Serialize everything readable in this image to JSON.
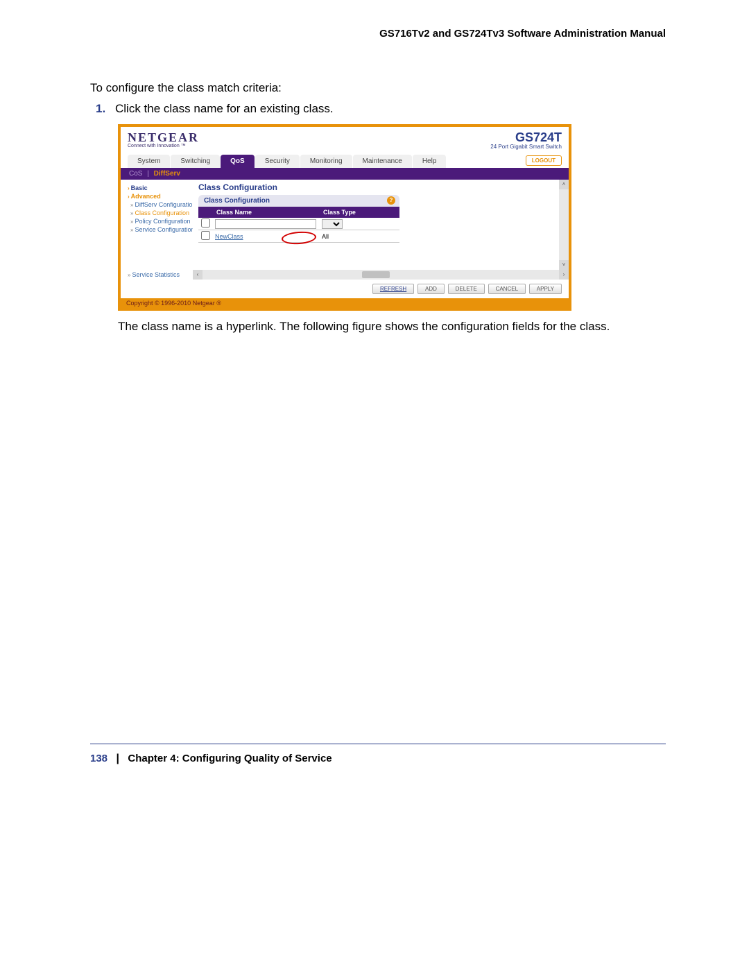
{
  "doc": {
    "header": "GS716Tv2 and GS724Tv3 Software Administration Manual",
    "intro": "To configure the class match criteria:",
    "step_num": "1.",
    "step_text": "Click the class name for an existing class.",
    "post_text": "The class name is a hyperlink. The following figure shows the configuration fields for the class.",
    "page_num": "138",
    "footer_sep": "|",
    "chapter": "Chapter 4:  Configuring Quality of Service"
  },
  "ss": {
    "logo": "NETGEAR",
    "logo_tag": "Connect with Innovation ™",
    "product": "GS724T",
    "product_tag": "24 Port Gigabit Smart Switch",
    "logout": "LOGOUT",
    "tabs": [
      "System",
      "Switching",
      "QoS",
      "Security",
      "Monitoring",
      "Maintenance",
      "Help"
    ],
    "active_tab": "QoS",
    "subtabs": {
      "a": "CoS",
      "b": "DiffServ",
      "sep": "|"
    },
    "sidebar": {
      "basic": "Basic",
      "advanced": "Advanced",
      "i0": "DiffServ Configuration",
      "i1": "Class Configuration",
      "i2": "Policy Configuration",
      "i3": "Service Configuration",
      "i4": "Service Statistics"
    },
    "main_title": "Class Configuration",
    "panel_title": "Class Configuration",
    "help_icon": "?",
    "th_name": "Class Name",
    "th_type": "Class Type",
    "row_link": "NewClass",
    "row_type": "All",
    "copyright": "Copyright © 1996-2010 Netgear ®",
    "actions": [
      "REFRESH",
      "ADD",
      "DELETE",
      "CANCEL",
      "APPLY"
    ],
    "arrows": {
      "up": "˄",
      "down": "˅",
      "left": "‹",
      "right": "›"
    }
  }
}
